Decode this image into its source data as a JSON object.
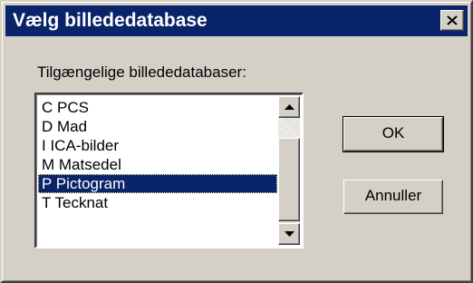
{
  "window": {
    "title": "Vælg billededatabase",
    "title_bar_color": "#0a246a",
    "close_icon": "close-icon"
  },
  "list": {
    "label": "Tilgængelige billededatabaser:",
    "items": [
      {
        "label": "C PCS",
        "selected": false
      },
      {
        "label": "D Mad",
        "selected": false
      },
      {
        "label": "I ICA-bilder",
        "selected": false
      },
      {
        "label": "M Matsedel",
        "selected": false
      },
      {
        "label": "P Pictogram",
        "selected": true
      },
      {
        "label": "T Tecknat",
        "selected": false
      }
    ],
    "selection_color": "#0a246a"
  },
  "buttons": {
    "ok_label": "OK",
    "cancel_label": "Annuller"
  }
}
